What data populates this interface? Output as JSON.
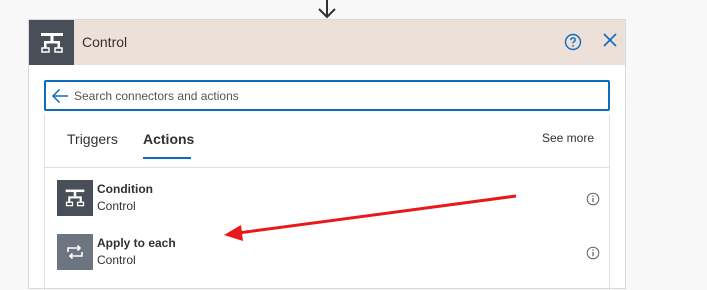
{
  "flow": {
    "connector_icon": "arrow-down-icon"
  },
  "card": {
    "title": "Control",
    "header_icon": "control-icon",
    "header_icon_bg": "#484f58",
    "header_bg": "#ede0d8",
    "help_icon": "help-circle-icon",
    "close_icon": "close-icon"
  },
  "search": {
    "placeholder": "Search connectors and actions",
    "value": "",
    "back_icon": "arrow-left-icon"
  },
  "tabs": [
    {
      "label": "Triggers",
      "selected": false
    },
    {
      "label": "Actions",
      "selected": true
    }
  ],
  "see_more": "See more",
  "actions": [
    {
      "title": "Condition",
      "subtitle": "Control",
      "icon": "condition-icon",
      "icon_bg": "#484f58"
    },
    {
      "title": "Apply to each",
      "subtitle": "Control",
      "icon": "loop-icon",
      "icon_bg": "#6c7580"
    }
  ],
  "annotation": {
    "type": "red-arrow",
    "color": "#e8191a",
    "points_to": "Apply to each"
  },
  "colors": {
    "accent": "#0f6cbd"
  }
}
